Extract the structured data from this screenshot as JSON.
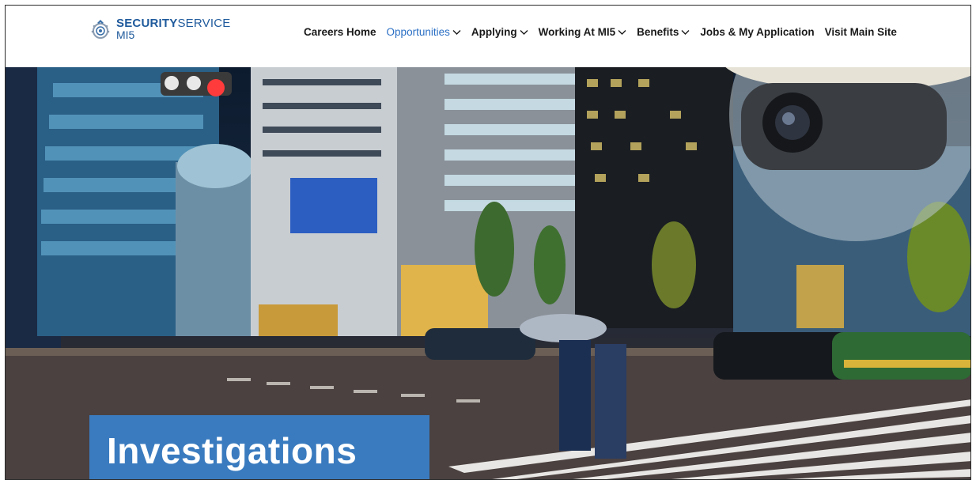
{
  "brand": {
    "line1_bold": "SECURITY",
    "line1_light": "SERVICE",
    "line2": "MI5",
    "emblem_icon": "crest-icon",
    "color": "#1f5a9c"
  },
  "nav": {
    "items": [
      {
        "label": "Careers Home",
        "has_dropdown": false,
        "active": false
      },
      {
        "label": "Opportunities",
        "has_dropdown": true,
        "active": true
      },
      {
        "label": "Applying",
        "has_dropdown": true,
        "active": false
      },
      {
        "label": "Working At MI5",
        "has_dropdown": true,
        "active": false
      },
      {
        "label": "Benefits",
        "has_dropdown": true,
        "active": false
      },
      {
        "label": "Jobs & My Application",
        "has_dropdown": false,
        "active": false
      },
      {
        "label": "Visit Main Site",
        "has_dropdown": false,
        "active": false
      }
    ],
    "active_color": "#2a6fc4"
  },
  "hero": {
    "title": "Investigations",
    "title_bg": "#3a7bbf",
    "image": "night-city-street-with-cctv-dome-camera"
  }
}
